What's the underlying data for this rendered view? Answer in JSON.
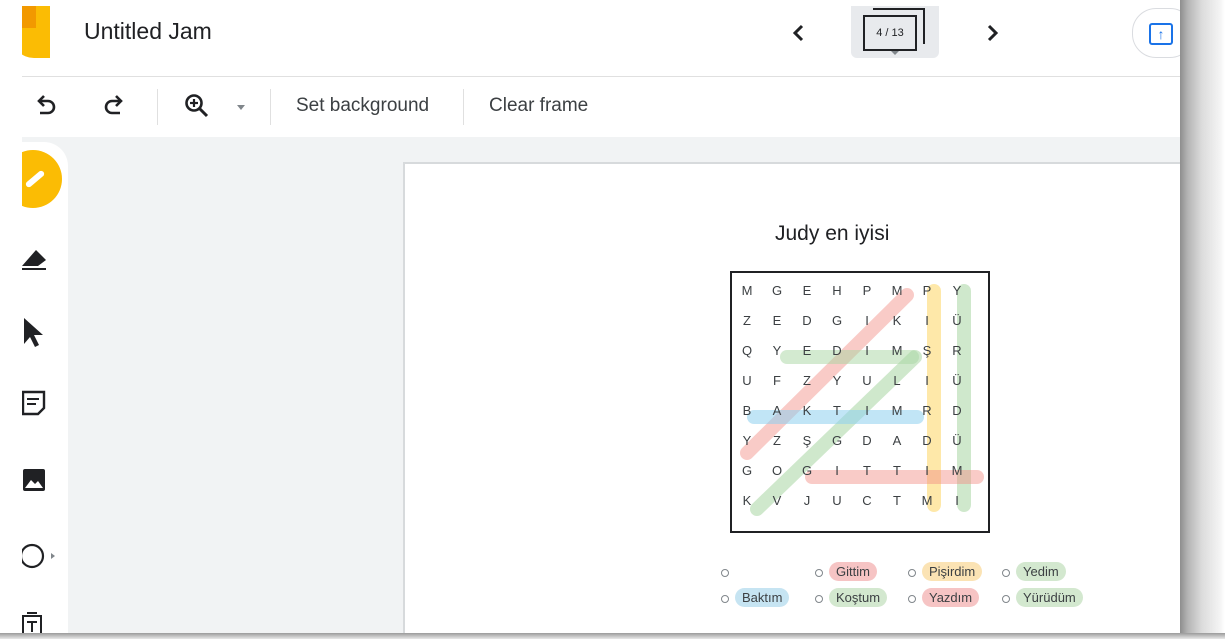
{
  "app": {
    "title": "Untitled Jam",
    "frame_counter": "4 / 13",
    "prev_icon": "chevron-left-icon",
    "next_icon": "chevron-right-icon"
  },
  "toolbar": {
    "undo_icon": "undo-icon",
    "redo_icon": "redo-icon",
    "zoom_icon": "zoom-in-icon",
    "set_background": "Set background",
    "clear_frame": "Clear frame"
  },
  "sidebar": {
    "tools": [
      "pen-icon",
      "eraser-icon",
      "select-pointer-icon",
      "sticky-note-icon",
      "image-icon",
      "shape-circle-icon",
      "text-box-icon"
    ]
  },
  "frame": {
    "title": "Judy en iyisi",
    "grid": [
      [
        "M",
        "G",
        "E",
        "H",
        "P",
        "M",
        "P",
        "Y"
      ],
      [
        "Z",
        "E",
        "D",
        "G",
        "I",
        "K",
        "I",
        "Ü"
      ],
      [
        "Q",
        "Y",
        "E",
        "D",
        "I",
        "M",
        "Ş",
        "R"
      ],
      [
        "U",
        "F",
        "Z",
        "Y",
        "U",
        "L",
        "I",
        "Ü"
      ],
      [
        "B",
        "A",
        "K",
        "T",
        "I",
        "M",
        "R",
        "D"
      ],
      [
        "Y",
        "Z",
        "Ş",
        "G",
        "D",
        "A",
        "D",
        "Ü"
      ],
      [
        "G",
        "O",
        "G",
        "I",
        "T",
        "T",
        "I",
        "M"
      ],
      [
        "K",
        "V",
        "J",
        "U",
        "C",
        "T",
        "M",
        "I"
      ]
    ],
    "words": [
      {
        "label": "",
        "color": ""
      },
      {
        "label": "Gittim",
        "color": "#f6c4c4"
      },
      {
        "label": "Pişirdim",
        "color": "#fbe3b4"
      },
      {
        "label": "Yedim",
        "color": "#d3e8cf"
      },
      {
        "label": "Baktım",
        "color": "#c6e4f2"
      },
      {
        "label": "Koştum",
        "color": "#d3e8cf"
      },
      {
        "label": "Yazdım",
        "color": "#f6c4c4"
      },
      {
        "label": "Yürüdüm",
        "color": "#d3e8cf"
      }
    ],
    "highlight_colors": {
      "red": "#f28b82",
      "yellow": "#fdd663",
      "green": "#a8d5a2",
      "blue": "#8ecfee"
    }
  }
}
